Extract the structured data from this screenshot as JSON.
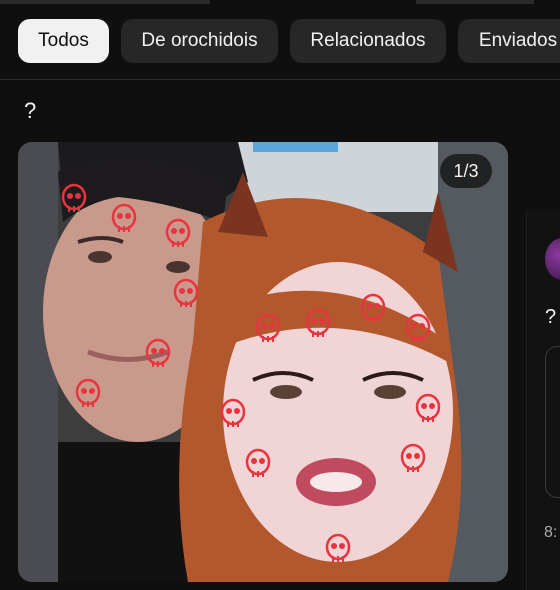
{
  "chips": [
    {
      "label": "Todos",
      "active": true
    },
    {
      "label": "De orochidois",
      "active": false
    },
    {
      "label": "Relacionados",
      "active": false
    },
    {
      "label": "Enviados",
      "active": false
    }
  ],
  "post": {
    "text": "?",
    "image_counter": "1/3"
  },
  "side_post": {
    "text": "?",
    "time": "8:"
  },
  "colors": {
    "background": "#0f0f0f",
    "chip_active": "#f1f1f1",
    "chip_inactive": "#272727",
    "skull_filter": "#e8343f"
  }
}
